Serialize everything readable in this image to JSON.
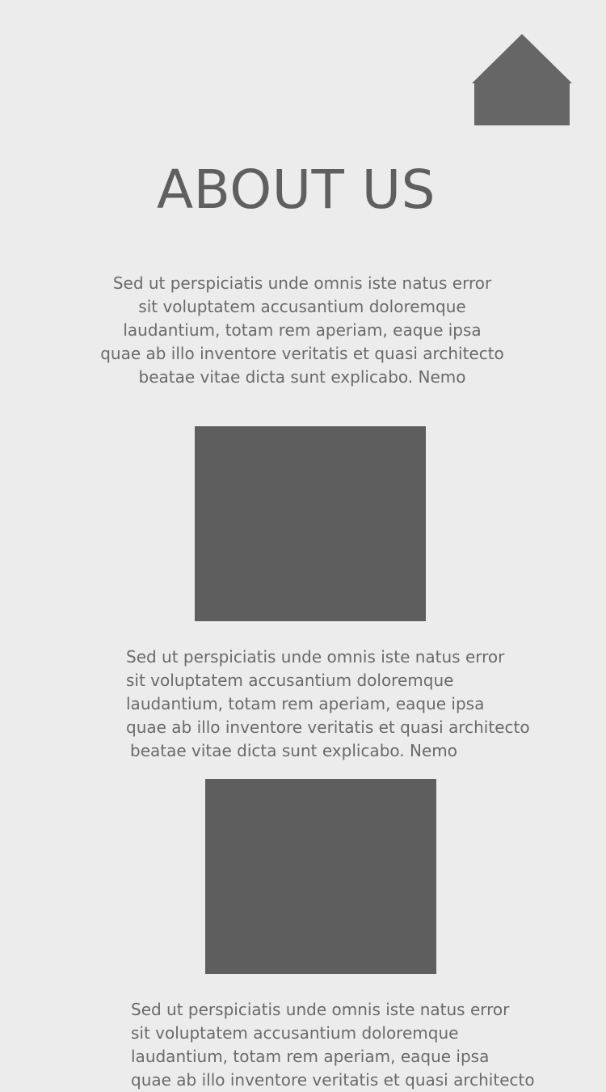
{
  "header": {
    "home_icon": "home-icon",
    "title": "ABOUT US"
  },
  "sections": [
    {
      "text": [
        "Sed ut perspiciatis unde omnis iste natus error",
        "sit voluptatem accusantium doloremque",
        "laudantium, totam rem aperiam, eaque ipsa",
        "quae ab illo inventore veritatis et quasi architecto",
        "beatae vitae dicta sunt explicabo. Nemo"
      ]
    },
    {
      "text": [
        "Sed ut perspiciatis unde omnis iste natus error",
        "sit voluptatem accusantium doloremque",
        "laudantium, totam rem aperiam, eaque ipsa",
        "quae ab illo inventore veritatis et quasi architecto",
        "beatae vitae dicta sunt explicabo. Nemo"
      ]
    },
    {
      "text": [
        "Sed ut perspiciatis unde omnis iste natus error",
        "sit voluptatem accusantium doloremque",
        "laudantium, totam rem aperiam, eaque ipsa",
        "quae ab illo inventore veritatis et quasi architecto"
      ]
    }
  ],
  "colors": {
    "background": "#ececec",
    "icon": "#666666",
    "placeholder": "#5e5e5e",
    "text": "#6a6a6a"
  }
}
